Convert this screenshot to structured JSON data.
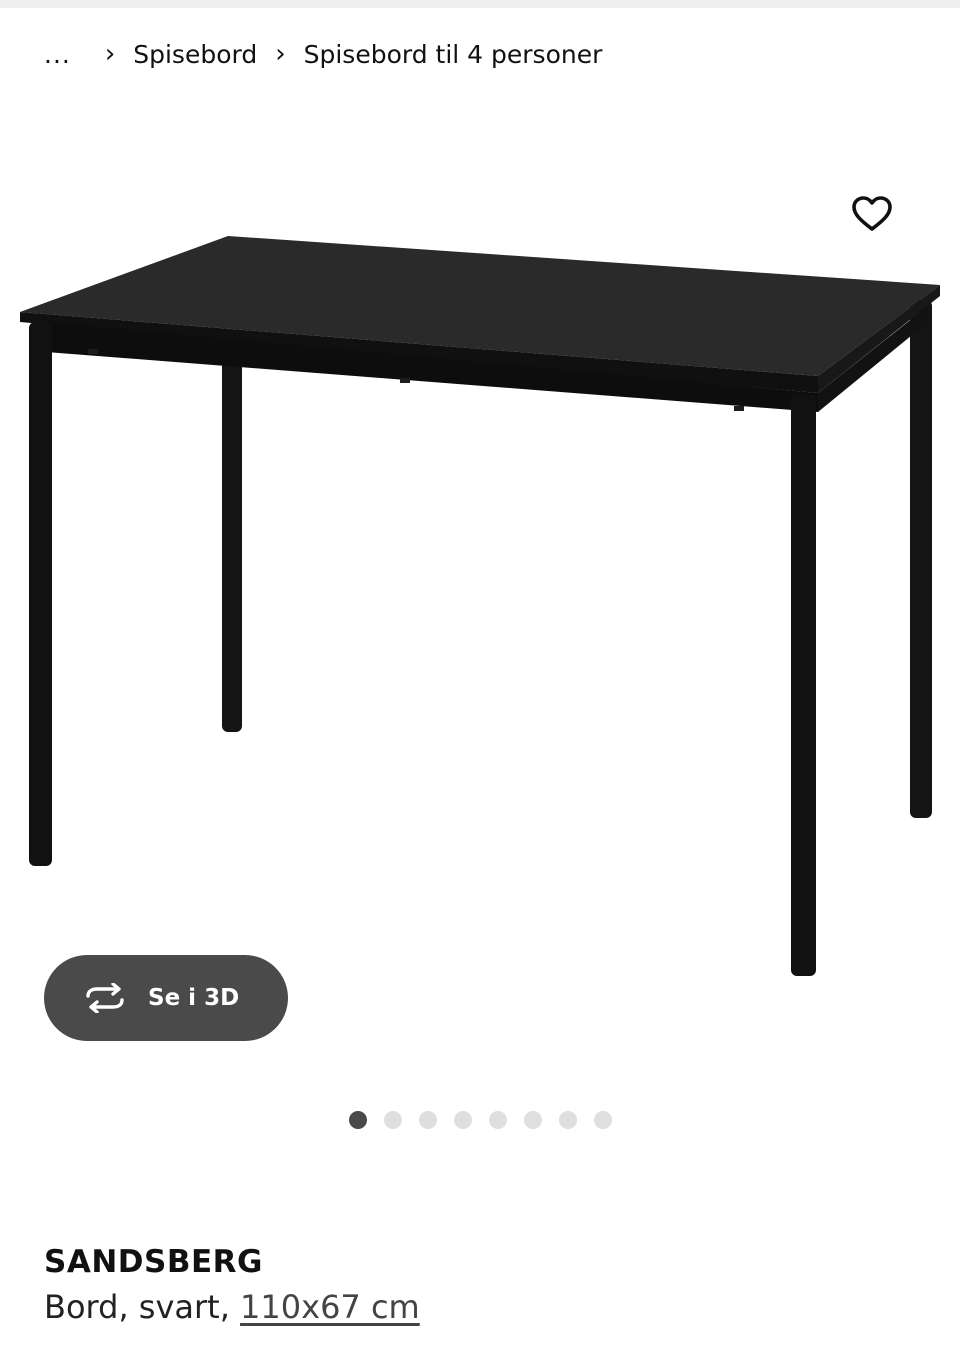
{
  "breadcrumb": {
    "ellipsis": "...",
    "separator": "›",
    "items": [
      {
        "label": "Spisebord"
      },
      {
        "label": "Spisebord til 4 personer"
      }
    ]
  },
  "icons": {
    "favourite": "heart-outline-icon",
    "rotate": "rotate-3d-icon",
    "chevron": "chevron-right-icon"
  },
  "gallery": {
    "see_3d_label": "Se i 3D",
    "dots_total": 8,
    "active_dot": 1
  },
  "product": {
    "name": "SANDSBERG",
    "description_prefix": "Bord, svart, ",
    "size": "110x67 cm"
  },
  "colors": {
    "button_bg": "#4a4a4a",
    "dot_active": "#4a4a4a",
    "dot_inactive": "#dfdfdf",
    "table_black": "#151515"
  }
}
